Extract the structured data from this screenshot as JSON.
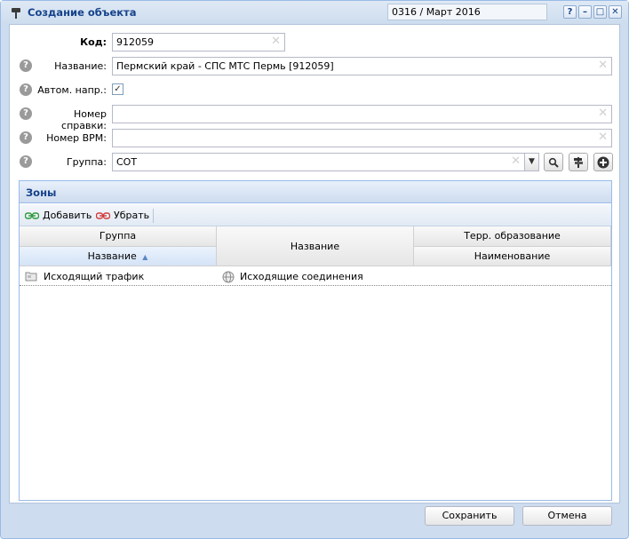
{
  "window": {
    "title": "Создание объекта",
    "period": "0316 / Март 2016",
    "tools": [
      "help-icon",
      "minimize-icon",
      "maximize-icon",
      "close-icon"
    ]
  },
  "form": {
    "code": {
      "label": "Код:",
      "value": "912059"
    },
    "name": {
      "label": "Название:",
      "value": "Пермский край - СПС МТС Пермь [912059]"
    },
    "auto": {
      "label": "Автом. напр.:",
      "checked": true,
      "mark": "✓"
    },
    "certificate": {
      "label": "Номер справки:",
      "value": ""
    },
    "vrm": {
      "label": "Номер ВРМ:",
      "value": ""
    },
    "group": {
      "label": "Группа:",
      "value": "СОТ"
    }
  },
  "zones": {
    "title": "Зоны",
    "toolbar": {
      "add": "Добавить",
      "remove": "Убрать"
    },
    "columns": {
      "group": "Группа",
      "group_name": "Название",
      "name": "Название",
      "terr": "Терр. образование",
      "terr_name": "Наименование"
    },
    "sort_indicator": "▲",
    "rows": [
      {
        "group_name": "Исходящий трафик",
        "name": "Исходящие соединения",
        "terr_name": ""
      }
    ]
  },
  "buttons": {
    "save": "Сохранить",
    "cancel": "Отмена"
  },
  "colors": {
    "title": "#15428b",
    "border": "#99bbe8"
  }
}
